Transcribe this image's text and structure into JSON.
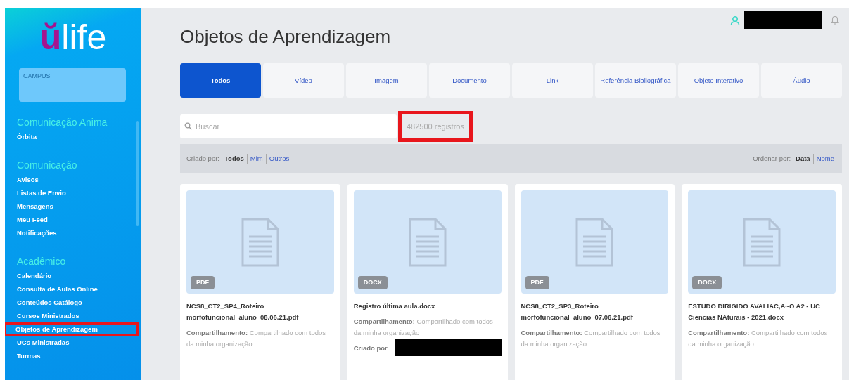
{
  "sidebar": {
    "logo": {
      "mark": "ŭ",
      "text": "life"
    },
    "campus": {
      "placeholder": "CAMPUS"
    },
    "sections": [
      {
        "heading": "Comunicação Anima",
        "items": [
          {
            "label": "Órbita",
            "highlighted": false
          }
        ]
      },
      {
        "heading": "Comunicação",
        "items": [
          {
            "label": "Avisos",
            "highlighted": false
          },
          {
            "label": "Listas de Envio",
            "highlighted": false
          },
          {
            "label": "Mensagens",
            "highlighted": false
          },
          {
            "label": "Meu Feed",
            "highlighted": false
          },
          {
            "label": "Notificações",
            "highlighted": false
          }
        ]
      },
      {
        "heading": "Acadêmico",
        "items": [
          {
            "label": "Calendário",
            "highlighted": false
          },
          {
            "label": "Consulta de Aulas Online",
            "highlighted": false
          },
          {
            "label": "Conteúdos Catálogo",
            "highlighted": false
          },
          {
            "label": "Cursos Ministrados",
            "highlighted": false
          },
          {
            "label": "Objetos de Aprendizagem",
            "highlighted": true
          },
          {
            "label": "UCs Ministradas",
            "highlighted": false
          },
          {
            "label": "Turmas",
            "highlighted": false
          }
        ]
      }
    ]
  },
  "page": {
    "title": "Objetos de Aprendizagem"
  },
  "tabs": [
    {
      "label": "Todos",
      "selected": true
    },
    {
      "label": "Vídeo",
      "selected": false
    },
    {
      "label": "Imagem",
      "selected": false
    },
    {
      "label": "Documento",
      "selected": false
    },
    {
      "label": "Link",
      "selected": false
    },
    {
      "label": "Referência Bibliográfica",
      "selected": false
    },
    {
      "label": "Objeto Interativo",
      "selected": false
    },
    {
      "label": "Áudio",
      "selected": false
    }
  ],
  "search": {
    "placeholder": "Buscar"
  },
  "count": {
    "text": "482500 registros",
    "highlighted": true
  },
  "filter": {
    "label": "Criado por:",
    "options": [
      {
        "label": "Todos",
        "selected": true
      },
      {
        "label": "Mim",
        "selected": false
      },
      {
        "label": "Outros",
        "selected": false
      }
    ],
    "sort_label": "Ordenar por:",
    "sort_options": [
      {
        "label": "Data",
        "selected": true
      },
      {
        "label": "Nome",
        "selected": false
      }
    ]
  },
  "cards": [
    {
      "type": "PDF",
      "title": "NCS8_CT2_SP4_Roteiro morfofuncional_aluno_08.06.21.pdf",
      "share_label": "Compartilhamento:",
      "share_value": "Compartilhado com todos da minha organização"
    },
    {
      "type": "DOCX",
      "title": "Registro última aula.docx",
      "share_label": "Compartilhamento:",
      "share_value": "Compartilhado com todos da minha organização",
      "created_by": "Criado por"
    },
    {
      "type": "PDF",
      "title": "NCS8_CT2_SP3_Roteiro morfofuncional_aluno_07.06.21.pdf",
      "share_label": "Compartilhamento:",
      "share_value": "Compartilhado com todos da minha organização"
    },
    {
      "type": "DOCX",
      "title": "ESTUDO DIRIGIDO AVALIAC,A~O A2 - UC Ciencias NAturais - 2021.docx",
      "share_label": "Compartilhamento:",
      "share_value": "Compartilhado com todos da minha organização"
    }
  ]
}
